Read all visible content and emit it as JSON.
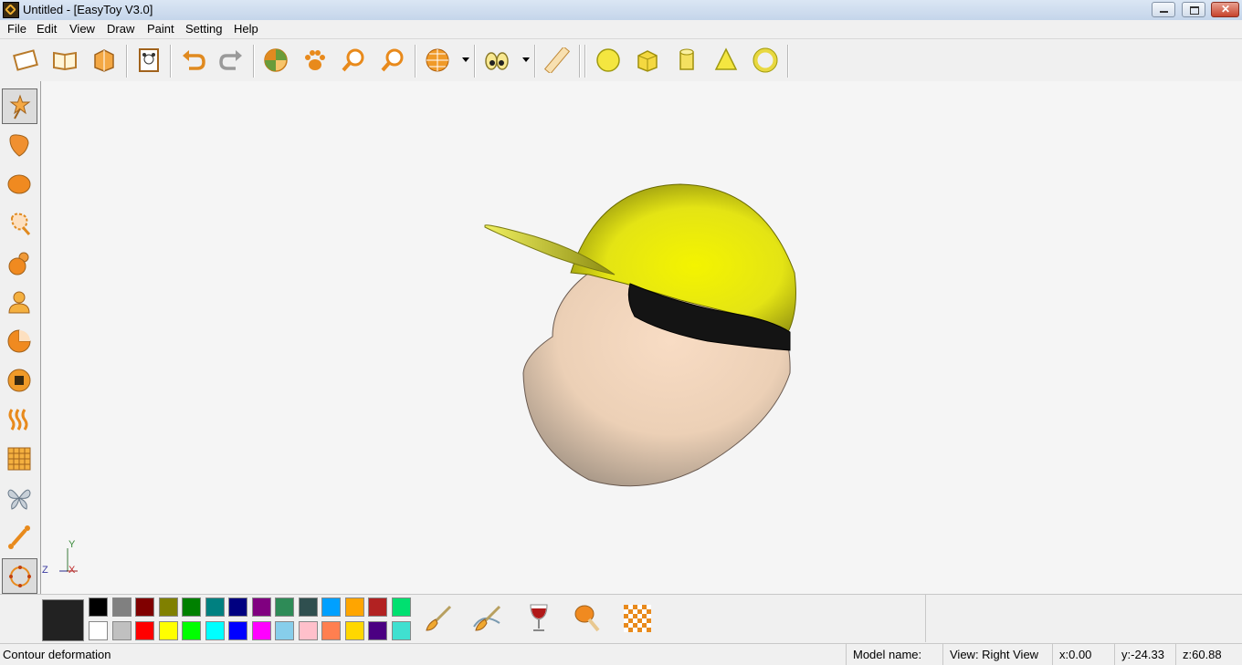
{
  "window": {
    "title": "Untitled - [EasyToy V3.0]"
  },
  "menu": [
    "File",
    "Edit",
    "View",
    "Draw",
    "Paint",
    "Setting",
    "Help"
  ],
  "toolbar_icons": [
    "new-document-icon",
    "open-book-icon",
    "save-box-icon",
    "bear-frame-icon",
    "undo-icon",
    "redo-icon",
    "pinwheel-icon",
    "paw-icon",
    "zoom-in-icon",
    "zoom-out-icon",
    "render-sphere-icon",
    "eyes-view-icon",
    "ruler-icon",
    "sphere-primitive-icon",
    "cube-primitive-icon",
    "cylinder-primitive-icon",
    "cone-primitive-icon",
    "torus-primitive-icon"
  ],
  "left_tools": [
    "magic-wand-icon",
    "balloon-shape-icon",
    "ellipsoid-icon",
    "lasso-shape-icon",
    "sphere-pair-icon",
    "figure-icon",
    "pie-cut-icon",
    "button-icon",
    "wave-stripes-icon",
    "grid-mesh-icon",
    "butterfly-icon",
    "bone-icon",
    "contour-deformation-icon"
  ],
  "axis": {
    "y": "Y",
    "z": "Z",
    "x": "X"
  },
  "palette": {
    "current": "#222222",
    "row1": [
      "#000000",
      "#808080",
      "#800000",
      "#808000",
      "#008000",
      "#008080",
      "#000080",
      "#800080",
      "#2e8b57",
      "#2f4f4f",
      "#00a0ff",
      "#ffa500",
      "#b22222",
      "#00e070"
    ],
    "row2": [
      "#ffffff",
      "#c0c0c0",
      "#ff0000",
      "#ffff00",
      "#00ff00",
      "#00ffff",
      "#0000ff",
      "#ff00ff",
      "#87ceeb",
      "#ffc0cb",
      "#ff7f50",
      "#ffd700",
      "#4b0082",
      "#40e0d0"
    ]
  },
  "paint_tools": [
    "brush-icon",
    "spray-brush-icon",
    "wine-glass-icon",
    "drumstick-icon",
    "checker-texture-icon"
  ],
  "status": {
    "message": "Contour deformation",
    "model_name": "Model name:",
    "view": "View: Right View",
    "x": "x:0.00",
    "y": "y:-24.33",
    "z": "z:60.88"
  }
}
